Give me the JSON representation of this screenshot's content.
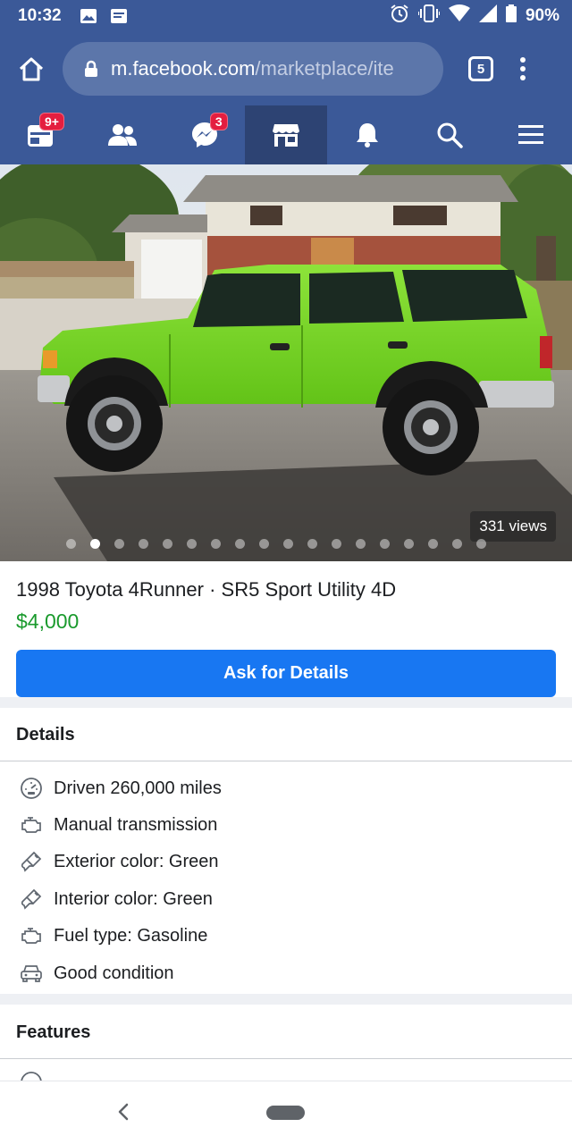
{
  "status_bar": {
    "time": "10:32",
    "battery": "90%",
    "left_icons": [
      "image-icon",
      "message-icon"
    ],
    "right_icons": [
      "alarm-icon",
      "vibrate-icon",
      "wifi-icon",
      "signal-icon",
      "battery-icon"
    ]
  },
  "browser": {
    "url_host": "m.facebook.com",
    "url_path": "/marketplace/ite",
    "tab_count": "5"
  },
  "fb_nav": {
    "items": [
      {
        "name": "feed",
        "icon": "feed-icon",
        "badge": "9+"
      },
      {
        "name": "friends",
        "icon": "friends-icon",
        "badge": ""
      },
      {
        "name": "messenger",
        "icon": "messenger-icon",
        "badge": "3"
      },
      {
        "name": "marketplace",
        "icon": "marketplace-icon",
        "badge": "",
        "active": true
      },
      {
        "name": "notifications",
        "icon": "bell-icon",
        "badge": ""
      },
      {
        "name": "search",
        "icon": "search-icon",
        "badge": ""
      },
      {
        "name": "menu",
        "icon": "hamburger-icon",
        "badge": ""
      }
    ]
  },
  "photo": {
    "views": "331 views",
    "dot_count": 18,
    "active_dot": 1
  },
  "listing": {
    "title": "1998 Toyota 4Runner · SR5 Sport Utility 4D",
    "price": "$4,000",
    "cta": "Ask for Details"
  },
  "details": {
    "heading": "Details",
    "rows": [
      {
        "icon": "speedometer-icon",
        "text": "Driven 260,000 miles"
      },
      {
        "icon": "engine-icon",
        "text": "Manual transmission"
      },
      {
        "icon": "paintbrush-icon",
        "text": "Exterior color: Green"
      },
      {
        "icon": "paintbrush-icon",
        "text": "Interior color: Green"
      },
      {
        "icon": "engine-icon",
        "text": "Fuel type: Gasoline"
      },
      {
        "icon": "car-icon",
        "text": "Good condition"
      }
    ]
  },
  "features": {
    "heading": "Features"
  },
  "colors": {
    "facebook_blue": "#3b5998",
    "cta_blue": "#1877f2",
    "price_green": "#1a9a2d",
    "vehicle_green": "#7ed321",
    "badge_red": "#e41e3f"
  }
}
